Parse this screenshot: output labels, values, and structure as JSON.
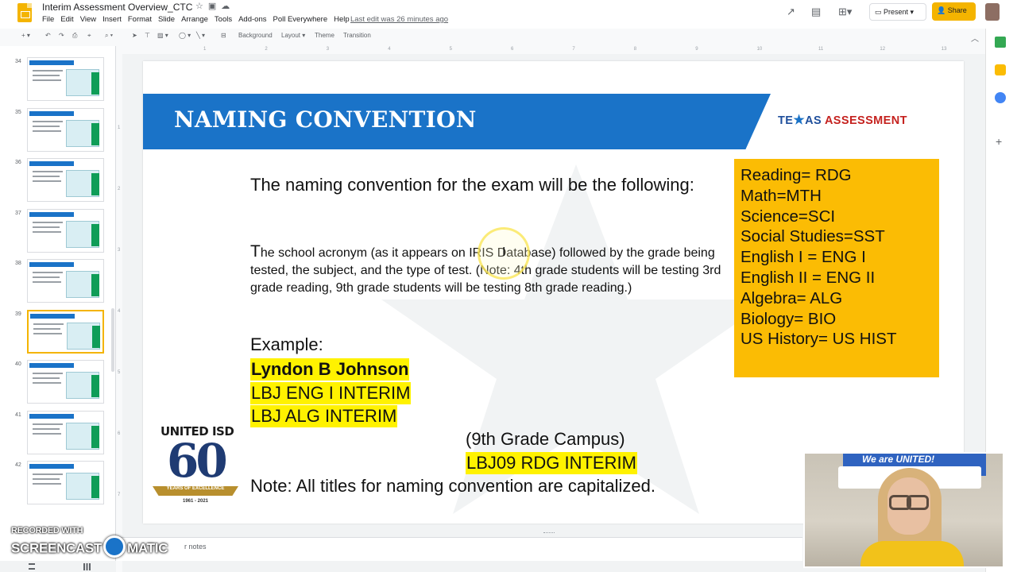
{
  "app": {
    "doc_title": "Interim Assessment Overview_CTC",
    "menu": [
      "File",
      "Edit",
      "View",
      "Insert",
      "Format",
      "Slide",
      "Arrange",
      "Tools",
      "Add-ons",
      "Poll Everywhere",
      "Help"
    ],
    "last_edit": "Last edit was 26 minutes ago",
    "present_label": "Present",
    "share_label": "Share"
  },
  "toolbar": {
    "background": "Background",
    "layout": "Layout",
    "theme": "Theme",
    "transition": "Transition"
  },
  "ruler": {
    "top_marks": [
      "1",
      "2",
      "3",
      "4",
      "5",
      "6",
      "7",
      "8",
      "9",
      "10",
      "11",
      "12",
      "13"
    ],
    "left_marks": [
      "1",
      "2",
      "3",
      "4",
      "5",
      "6",
      "7"
    ]
  },
  "filmstrip": {
    "slides": [
      {
        "num": "34"
      },
      {
        "num": "35"
      },
      {
        "num": "36"
      },
      {
        "num": "37"
      },
      {
        "num": "38"
      },
      {
        "num": "39",
        "selected": true
      },
      {
        "num": "40"
      },
      {
        "num": "41"
      },
      {
        "num": "42"
      }
    ]
  },
  "slide": {
    "title": "NAMING CONVENTION",
    "brand": {
      "pre": "TE",
      "post": "AS ",
      "accent": "ASSESSMENT"
    },
    "intro": "The naming convention for the exam will be the following:",
    "body_first_letter": "T",
    "body": "he school acronym (as it appears on IRIS Database) followed by the grade being tested, the subject, and the type of test.   (Note: 4th grade students will be testing 3rd grade reading, 9th grade students will be testing 8th grade reading.)",
    "example_label": "Example:",
    "example_name": "Lyndon B Johnson",
    "example_eng": "LBJ ENG I  INTERIM",
    "example_alg": "LBJ ALG INTERIM",
    "campus_label": "(9th Grade Campus)",
    "campus_code": "LBJ09 RDG INTERIM",
    "note": "Note:  All titles for naming convention are capitalized.",
    "codes": [
      "Reading= RDG",
      "Math=MTH",
      "Science=SCI",
      "Social Studies=SST",
      "English I = ENG I",
      "English II = ENG II",
      "Algebra= ALG",
      "Biology= BIO",
      "US History= US HIST"
    ],
    "district": {
      "name": "UNITED ISD",
      "number": "60",
      "tagline": "YEARS OF EXCELLENCE",
      "dates": "1961 - 2021"
    }
  },
  "notes": {
    "label": "r notes"
  },
  "watermark": {
    "recorded": "RECORDED WITH",
    "brand_pre": "SCREENCAST",
    "brand_post": "MATIC"
  },
  "webcam": {
    "banner": "We are UNITED!"
  },
  "colors": {
    "banner_blue": "#1a73c8",
    "code_box": "#fbbc04",
    "highlight": "#fff200",
    "share": "#f4b400"
  }
}
